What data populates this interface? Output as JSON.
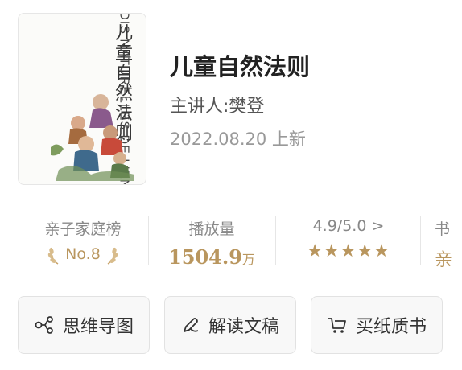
{
  "cover": {
    "title_cn": "儿童自然法则",
    "title_fr": "LES LOIS NATURELLES DE L'ENFANT",
    "author_fr": "CÉLINE ALVAREZ"
  },
  "book": {
    "title": "儿童自然法则",
    "speaker": "主讲人:樊登",
    "date": "2022.08.20 上新"
  },
  "stats": [
    {
      "label": "亲子家庭榜",
      "value": "No.8"
    },
    {
      "label": "播放量",
      "value": "1504.9",
      "unit": "万"
    },
    {
      "label": "4.9/5.0 >",
      "stars": "★★★★★",
      "rating": 5
    },
    {
      "label": "书",
      "value": "亲"
    }
  ],
  "actions": [
    {
      "label": "思维导图",
      "icon": "mindmap-icon"
    },
    {
      "label": "解读文稿",
      "icon": "pen-icon"
    },
    {
      "label": "买纸质书",
      "icon": "cart-icon"
    }
  ],
  "colors": {
    "gold": "#b9965e",
    "star": "#c8a36a"
  }
}
